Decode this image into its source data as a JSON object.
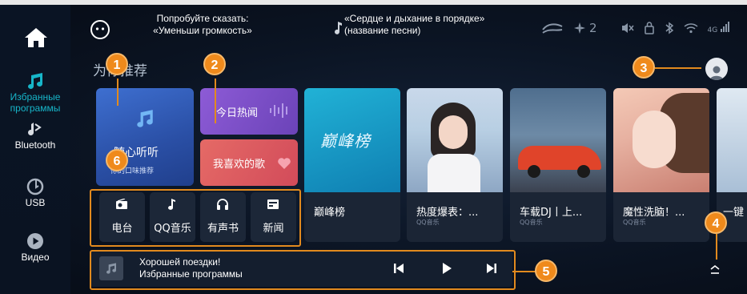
{
  "sidebar": {
    "home_label": "",
    "items": [
      {
        "label": "Избранные программы",
        "icon": "music-note-icon",
        "active": true
      },
      {
        "label": "Bluetooth",
        "icon": "bluetooth-music-icon"
      },
      {
        "label": "USB",
        "icon": "usb-icon"
      },
      {
        "label": "Видео",
        "icon": "play-circle-icon"
      }
    ]
  },
  "topbar": {
    "voice_hint": "Попробуйте сказать: «Уменьши громкость»",
    "song": "«Сердце и дыхание в порядке» (название песни)",
    "fan_level": "2",
    "signal": "4G"
  },
  "main": {
    "section_title": "为你推荐",
    "fav_card": {
      "title": "随心听听",
      "subtitle": "你的口味推荐"
    },
    "hot_card": {
      "title": "今日热闻"
    },
    "like_card": {
      "title": "我喜欢的歌"
    },
    "shortcuts": [
      {
        "label": "电台",
        "icon": "radio-icon"
      },
      {
        "label": "QQ音乐",
        "icon": "music-note-icon"
      },
      {
        "label": "有声书",
        "icon": "headphones-icon"
      },
      {
        "label": "新闻",
        "icon": "news-icon"
      }
    ],
    "tiles": [
      {
        "title": "巅峰榜",
        "subtitle": "",
        "art_text": "巅峰榜"
      },
      {
        "title": "热度爆表：...",
        "subtitle": "QQ音乐"
      },
      {
        "title": "车载DJ丨上...",
        "subtitle": "QQ音乐"
      },
      {
        "title": "魔性洗脑！...",
        "subtitle": "QQ音乐"
      },
      {
        "title": "一键",
        "subtitle": ""
      }
    ]
  },
  "player": {
    "line1": "Хорошей поездки!",
    "line2": "Избранные программы"
  },
  "callouts": [
    "1",
    "2",
    "3",
    "4",
    "5",
    "6"
  ],
  "colors": {
    "accent": "#17b6c9",
    "callout": "#ef8a1c",
    "background": "#0b1220"
  }
}
